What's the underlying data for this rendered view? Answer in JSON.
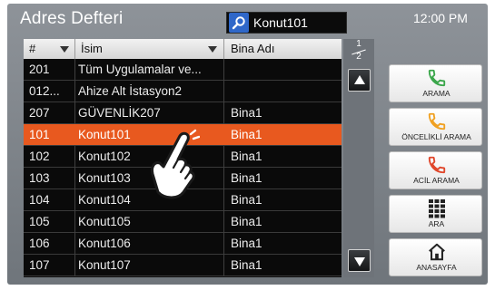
{
  "header": {
    "title": "Adres Defteri",
    "search_value": "Konut101",
    "clock": "12:00 PM"
  },
  "table": {
    "columns": [
      "#",
      "İsim",
      "Bina Adı"
    ],
    "rows": [
      {
        "no": "201",
        "name": "Tüm Uygulamalar ve...",
        "building": ""
      },
      {
        "no": "012...",
        "name": "Ahize Alt İstasyon2",
        "building": ""
      },
      {
        "no": "207",
        "name": "GÜVENLİK207",
        "building": "Bina1"
      },
      {
        "no": "101",
        "name": "Konut101",
        "building": "Bina1"
      },
      {
        "no": "102",
        "name": "Konut102",
        "building": "Bina1"
      },
      {
        "no": "103",
        "name": "Konut103",
        "building": "Bina1"
      },
      {
        "no": "104",
        "name": "Konut104",
        "building": "Bina1"
      },
      {
        "no": "105",
        "name": "Konut105",
        "building": "Bina1"
      },
      {
        "no": "106",
        "name": "Konut106",
        "building": "Bina1"
      },
      {
        "no": "107",
        "name": "Konut107",
        "building": "Bina1"
      }
    ],
    "selected_index": 3
  },
  "pager": {
    "current": "1",
    "total": "2"
  },
  "side_buttons": [
    {
      "label": "ARAMA",
      "icon": "phone-icon",
      "color": "#3aa64a"
    },
    {
      "label": "ÖNCELİKLİ ARAMA",
      "icon": "phone-icon",
      "color": "#f0a020"
    },
    {
      "label": "ACİL ARAMA",
      "icon": "phone-icon",
      "color": "#e0462a"
    },
    {
      "label": "ARA",
      "icon": "keypad-icon",
      "color": "#222222"
    },
    {
      "label": "ANASAYFA",
      "icon": "home-icon",
      "color": "#222222"
    }
  ],
  "colors": {
    "selected_row": "#e8591f",
    "search_icon_bg": "#2f67c9"
  }
}
